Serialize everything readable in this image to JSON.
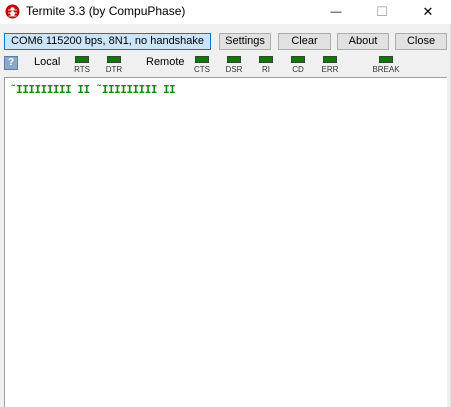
{
  "window": {
    "title": "Termite 3.3 (by CompuPhase)",
    "minimize_glyph": "—",
    "maximize_glyph": "☐",
    "close_glyph": "✕"
  },
  "toolbar": {
    "port_status": "COM6 115200 bps, 8N1, no handshake",
    "settings_label": "Settings",
    "clear_label": "Clear",
    "about_label": "About",
    "close_label": "Close",
    "help_glyph": "?"
  },
  "status": {
    "local_label": "Local",
    "remote_label": "Remote",
    "local_leds": [
      "RTS",
      "DTR"
    ],
    "remote_leds": [
      "CTS",
      "DSR",
      "RI",
      "CD",
      "ERR"
    ],
    "break_led": "BREAK"
  },
  "terminal": {
    "lines": [
      "˜IIIIIIIII II ˜IIIIIIIII II"
    ]
  },
  "colors": {
    "led_on": "#0a7a0a",
    "terminal_text": "#138a13",
    "port_box_bg": "#cce4f7",
    "app_icon": "#c00000"
  },
  "icons": {
    "app": "termite-ant-icon",
    "help": "help-icon"
  }
}
